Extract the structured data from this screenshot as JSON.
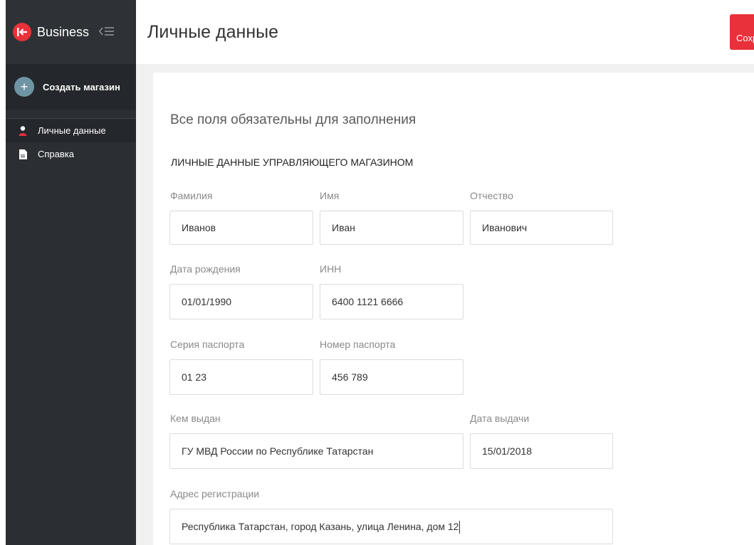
{
  "sidebar": {
    "brand": "Business",
    "create_shop": "Создать магазин",
    "items": [
      {
        "label": "Личные данные",
        "icon": "person-icon",
        "active": true
      },
      {
        "label": "Справка",
        "icon": "document-icon",
        "active": false
      }
    ]
  },
  "header": {
    "title": "Личные данные",
    "save_label": "Сохранить"
  },
  "form": {
    "note": "Все поля обязательны для заполнения",
    "section_title": "ЛИЧНЫЕ ДАННЫЕ УПРАВЛЯЮЩЕГО МАГАЗИНОМ",
    "last_name": {
      "label": "Фамилия",
      "value": "Иванов"
    },
    "first_name": {
      "label": "Имя",
      "value": "Иван"
    },
    "patronymic": {
      "label": "Отчество",
      "value": "Иванович"
    },
    "birth_date": {
      "label": "Дата рождения",
      "value": "01/01/1990"
    },
    "inn": {
      "label": "ИНН",
      "value": "6400 1121 6666"
    },
    "passport_series": {
      "label": "Серия паспорта",
      "value": "01 23"
    },
    "passport_number": {
      "label": "Номер паспорта",
      "value": "456 789"
    },
    "issued_by": {
      "label": "Кем выдан",
      "value": "ГУ МВД России по Республике Татарстан"
    },
    "issue_date": {
      "label": "Дата выдачи",
      "value": "15/01/2018"
    },
    "address": {
      "label": "Адрес регистрации",
      "value": "Республика Татарстан, город Казань, улица Ленина, дом 12"
    }
  },
  "colors": {
    "accent": "#e8313a",
    "sidebar": "#2b2f33"
  }
}
